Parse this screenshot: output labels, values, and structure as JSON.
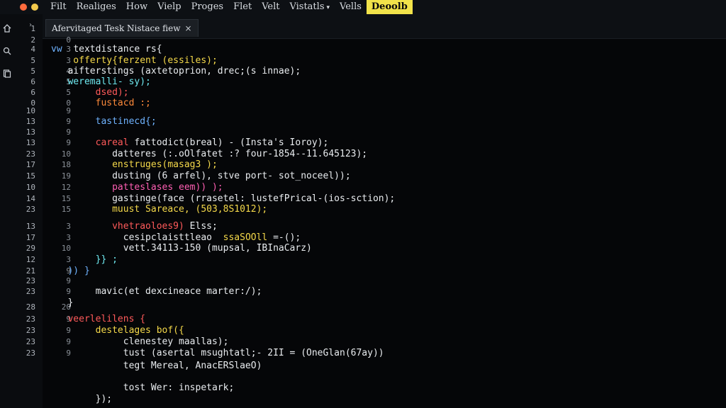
{
  "menubar": {
    "items": [
      {
        "label": "Filt",
        "active": false
      },
      {
        "label": "Realiges",
        "active": false
      },
      {
        "label": "How",
        "active": false
      },
      {
        "label": "Vielp",
        "active": false
      },
      {
        "label": "Proges",
        "active": false
      },
      {
        "label": "Flet",
        "active": false
      },
      {
        "label": "Velt",
        "active": false
      },
      {
        "label": "Vistatls",
        "active": false,
        "has_caret": true
      },
      {
        "label": "Vells",
        "active": false
      },
      {
        "label": "Deoolb",
        "active": true
      }
    ],
    "window_dots": [
      "#ff6b3d",
      "#f2c94c"
    ]
  },
  "tab": {
    "label": "Afervitaged Tesk Nistace fiew",
    "close_glyph": "×"
  },
  "gutter": {
    "primary": [
      "1",
      "2",
      "4",
      "5",
      "5",
      "6",
      "6",
      "0",
      "10",
      "13",
      "13",
      "13",
      "23",
      "17",
      "15",
      "10",
      "14",
      "23",
      "13",
      "17",
      "29",
      "12",
      "21",
      "23",
      "23",
      "28",
      "23",
      "23",
      "23",
      "23"
    ],
    "secondary": [
      "",
      "0",
      "3",
      "3",
      "4",
      "5",
      "5",
      "0",
      "9",
      "9",
      "9",
      "9",
      "10",
      "18",
      "19",
      "12",
      "15",
      "15",
      "3",
      "3",
      "10",
      "3",
      "9",
      "9",
      "9",
      "20",
      "9",
      "9",
      "9",
      "9"
    ]
  },
  "code": {
    "lines": [
      [
        {
          "t": "vw  ",
          "c": "c-blue"
        },
        {
          "t": "textdistance rs{",
          "c": "c-white"
        }
      ],
      [
        {
          "t": "    offerty{ferzent (essiles);",
          "c": "c-yellow"
        }
      ],
      [
        {
          "t": "   aifterstings (axtetoprion, drec;(s innae);",
          "c": "c-white"
        }
      ],
      [
        {
          "t": "   weremalli- sy);",
          "c": "c-cyan"
        }
      ],
      [
        {
          "t": "        dsed);",
          "c": "c-red"
        }
      ],
      [
        {
          "t": "        fustacd :;",
          "c": "c-orange"
        }
      ],
      [
        {
          "t": "        tastinecd{;",
          "c": "c-blue"
        }
      ],
      [
        {
          "t": "        careal ",
          "c": "c-red"
        },
        {
          "t": "fattodict(breal) - (Insta's Ioroy);",
          "c": "c-white"
        }
      ],
      [
        {
          "t": "           datteres (:.oOlfatet :? four-1854--11.645123);",
          "c": "c-white"
        }
      ],
      [
        {
          "t": "           enstruges(masag3 );",
          "c": "c-yellow"
        }
      ],
      [
        {
          "t": "           dusting (6 arfel), stve port- sot_noceel));",
          "c": "c-white"
        }
      ],
      [
        {
          "t": "           patteslases eem)) );",
          "c": "c-pink"
        }
      ],
      [
        {
          "t": "           gastinge(face (rrasetel: lustefPrical-(ios-sction);",
          "c": "c-white"
        }
      ],
      [
        {
          "t": "           muust Sareace, (503,8S1012);",
          "c": "c-yellow"
        }
      ],
      [
        {
          "t": "           vhetraoloes9) ",
          "c": "c-red"
        },
        {
          "t": "Elss;",
          "c": "c-white"
        }
      ],
      [
        {
          "t": "             cesipclaisttleao  ",
          "c": "c-white"
        },
        {
          "t": "ssaSOOll ",
          "c": "c-yellow"
        },
        {
          "t": "=-();",
          "c": "c-white"
        }
      ],
      [
        {
          "t": "             vett.34113-150 (mupsal, IBInaCarz)",
          "c": "c-white"
        }
      ],
      [
        {
          "t": "        }} ;",
          "c": "c-cyan"
        }
      ],
      [
        {
          "t": "   )) }",
          "c": "c-blue"
        }
      ],
      [
        {
          "t": "        mavic(et dexcineace marter:/);",
          "c": "c-white"
        }
      ],
      [
        {
          "t": "   }",
          "c": "c-white"
        }
      ],
      [
        {
          "t": "   veerlelilens {",
          "c": "c-red"
        }
      ],
      [
        {
          "t": "        destelages bof({",
          "c": "c-yellow"
        }
      ],
      [
        {
          "t": "             clenestey maallas);",
          "c": "c-white"
        }
      ],
      [
        {
          "t": "             tust (asertal msughtatl;- 2II = (OneGlan(67ay))",
          "c": "c-white"
        }
      ],
      [
        {
          "t": "             tegt Mereal, AnacERSlaeO)",
          "c": "c-white"
        }
      ],
      [
        {
          "t": "             tost Wer: inspetark;",
          "c": "c-white"
        }
      ],
      [
        {
          "t": "        });",
          "c": "c-white"
        }
      ]
    ]
  }
}
